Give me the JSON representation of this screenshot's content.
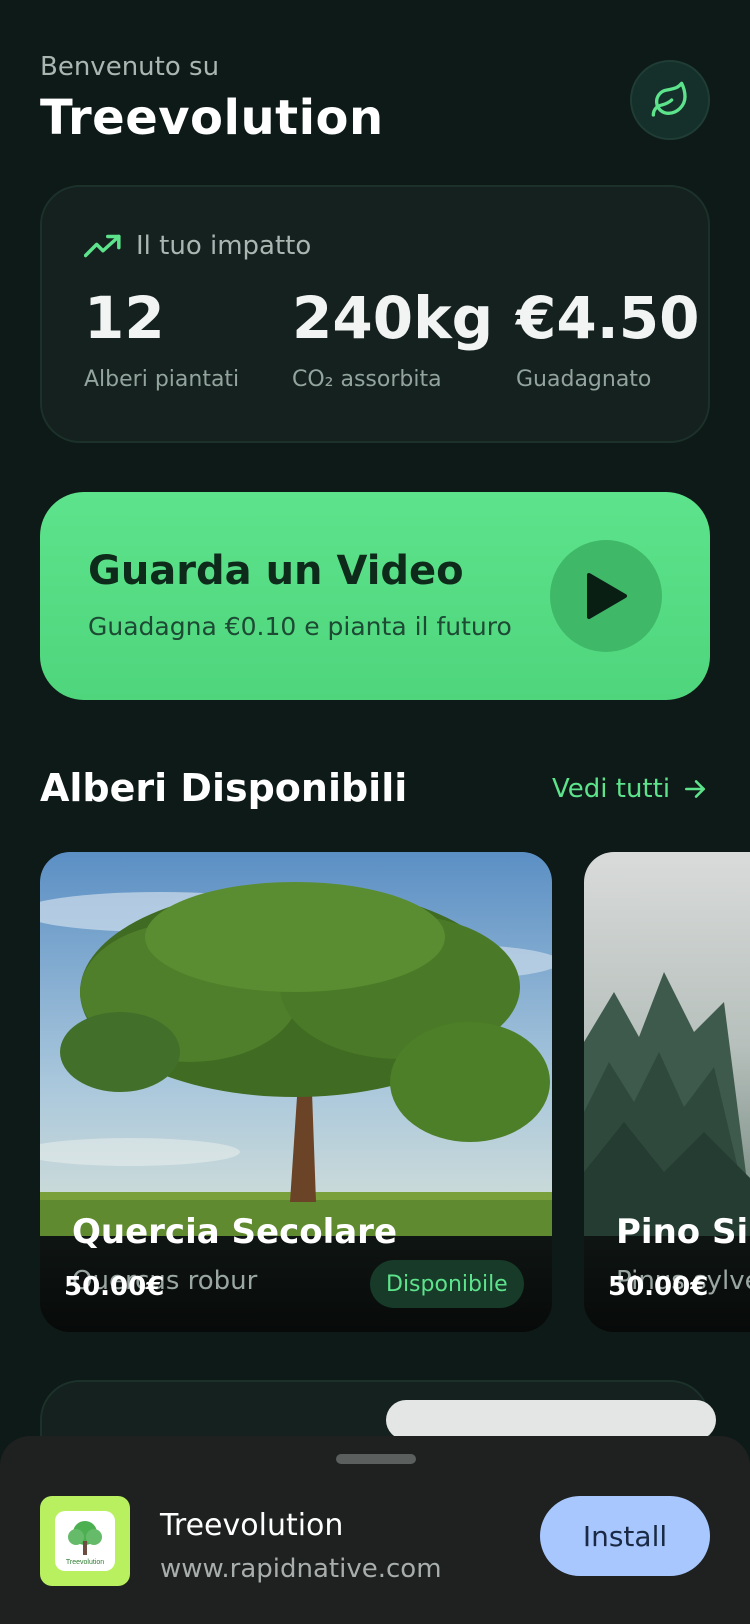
{
  "header": {
    "welcome_text": "Benvenuto su",
    "app_title": "Treevolution"
  },
  "impact": {
    "label": "Il tuo impatto",
    "stats": [
      {
        "value": "12",
        "caption": "Alberi piantati"
      },
      {
        "value": "240kg",
        "caption": "CO₂ assorbita"
      },
      {
        "value": "€4.50",
        "caption": "Guadagnato"
      }
    ]
  },
  "video_cta": {
    "title": "Guarda un Video",
    "subtitle": "Guadagna €0.10 e pianta il futuro"
  },
  "trees_section": {
    "title": "Alberi Disponibili",
    "see_all": "Vedi tutti",
    "trees": [
      {
        "name": "Quercia Secolare",
        "latin": "Quercus robur",
        "price": "50.00€",
        "status": "Disponibile"
      },
      {
        "name": "Pino Silv",
        "latin": "Pinus sylve",
        "price": "50.00€",
        "status": ""
      }
    ]
  },
  "install_banner": {
    "app_name": "Treevolution",
    "url": "www.rapidnative.com",
    "install_label": "Install",
    "icon_text": "Treevolution"
  },
  "colors": {
    "background": "#0e1a17",
    "accent_green": "#5de38b",
    "card": "#14211e",
    "install_button": "#a9c7ff"
  }
}
